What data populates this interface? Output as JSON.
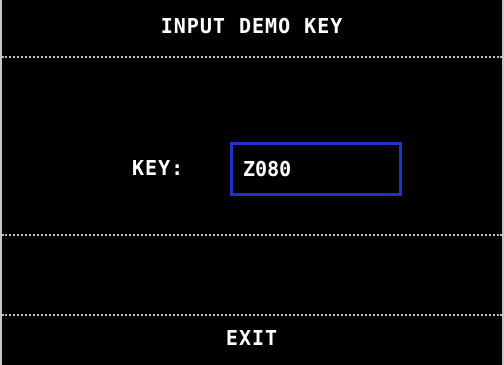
{
  "header": {
    "title": "INPUT DEMO KEY"
  },
  "form": {
    "key_label": "KEY:",
    "key_value": "Z080"
  },
  "footer": {
    "exit_label": "EXIT"
  },
  "colors": {
    "background": "#000000",
    "text": "#ffffff",
    "input_border": "#1f33cc",
    "divider": "#c0c0c0"
  }
}
